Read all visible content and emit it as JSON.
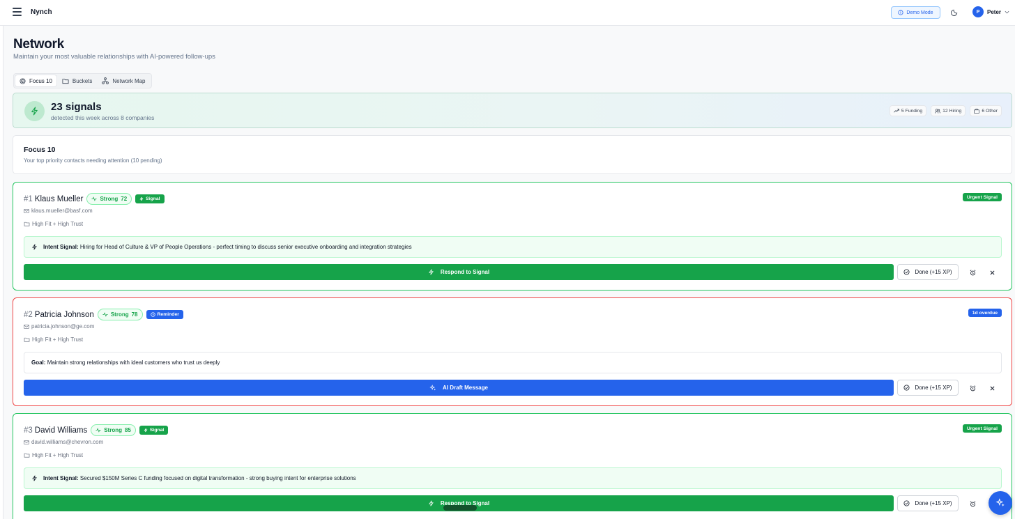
{
  "app": {
    "title": "Nynch"
  },
  "topbar": {
    "demo_label": "Demo Mode",
    "user_initial": "P",
    "user_name": "Peter"
  },
  "header": {
    "title": "Network",
    "subtitle": "Maintain your most valuable relationships with AI-powered follow-ups"
  },
  "tabs": [
    {
      "label": "Focus 10",
      "icon": "target-icon",
      "active": true
    },
    {
      "label": "Buckets",
      "icon": "folder-icon",
      "active": false
    },
    {
      "label": "Network Map",
      "icon": "network-icon",
      "active": false
    }
  ],
  "signals": {
    "count": "23 signals",
    "subtitle": "detected this week across 8 companies",
    "chips": [
      "5 Funding",
      "12 Hiring",
      "6 Other"
    ]
  },
  "focus": {
    "title": "Focus 10",
    "subtitle": "Your top priority contacts needing attention (10 pending)"
  },
  "contacts": [
    {
      "rank": "#1",
      "name": "Klaus Mueller",
      "strength_label": "Strong",
      "strength_score": "72",
      "badge": "Signal",
      "status": "Urgent Signal",
      "email": "klaus.mueller@basf.com",
      "bucket": "High Fit + High Trust",
      "note_label": "Intent Signal:",
      "note_text": "Hiring for Head of Culture & VP of People Operations - perfect timing to discuss senior executive onboarding and integration strategies",
      "action": "Respond to Signal",
      "done": "Done (+15 XP)"
    },
    {
      "rank": "#2",
      "name": "Patricia Johnson",
      "strength_label": "Strong",
      "strength_score": "78",
      "badge": "Reminder",
      "status": "1d overdue",
      "email": "patricia.johnson@ge.com",
      "bucket": "High Fit + High Trust",
      "note_label": "Goal:",
      "note_text": "Maintain strong relationships with ideal customers who trust us deeply",
      "action": "AI Draft Message",
      "done": "Done (+15 XP)"
    },
    {
      "rank": "#3",
      "name": "David Williams",
      "strength_label": "Strong",
      "strength_score": "85",
      "badge": "Signal",
      "status": "Urgent Signal",
      "email": "david.williams@chevron.com",
      "bucket": "High Fit + High Trust",
      "note_label": "Intent Signal:",
      "note_text": "Secured $150M Series C funding focused on digital transformation - strong buying intent for enterprise solutions",
      "action": "Respond to Signal",
      "done": "Done (+15 XP)"
    }
  ],
  "colors": {
    "green": "#16a34a",
    "blue": "#2563eb",
    "red": "#ef4444"
  }
}
